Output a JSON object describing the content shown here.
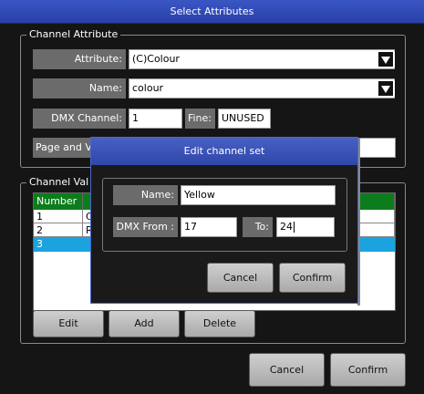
{
  "window": {
    "title": "Select Attributes"
  },
  "channel_attribute": {
    "group_title": "Channel Attribute",
    "attribute_label": "Attribute:",
    "attribute_value": "(C)Colour",
    "name_label": "Name:",
    "name_value": "colour",
    "dmx_channel_label": "DMX Channel:",
    "dmx_channel_value": "1",
    "fine_label": "Fine:",
    "fine_value": "UNUSED",
    "page_label": "Page and V",
    "page_value": ""
  },
  "channel_values": {
    "group_title": "Channel Val",
    "columns": [
      "Number",
      ""
    ],
    "rows": [
      {
        "number": "1",
        "value": "C"
      },
      {
        "number": "2",
        "value": "R"
      },
      {
        "number": "3",
        "value": ""
      }
    ],
    "edit_label": "Edit",
    "add_label": "Add",
    "delete_label": "Delete"
  },
  "footer": {
    "cancel_label": "Cancel",
    "confirm_label": "Confirm"
  },
  "dialog": {
    "title": "Edit channel set",
    "name_label": "Name:",
    "name_value": "Yellow",
    "dmx_from_label": "DMX From :",
    "dmx_from_value": "17",
    "to_label": "To:",
    "to_value": "24",
    "cancel_label": "Cancel",
    "confirm_label": "Confirm"
  },
  "colors": {
    "title_blue": "#3a56c4",
    "header_green": "#0c7d1c",
    "selected_row": "#1ba3df"
  }
}
